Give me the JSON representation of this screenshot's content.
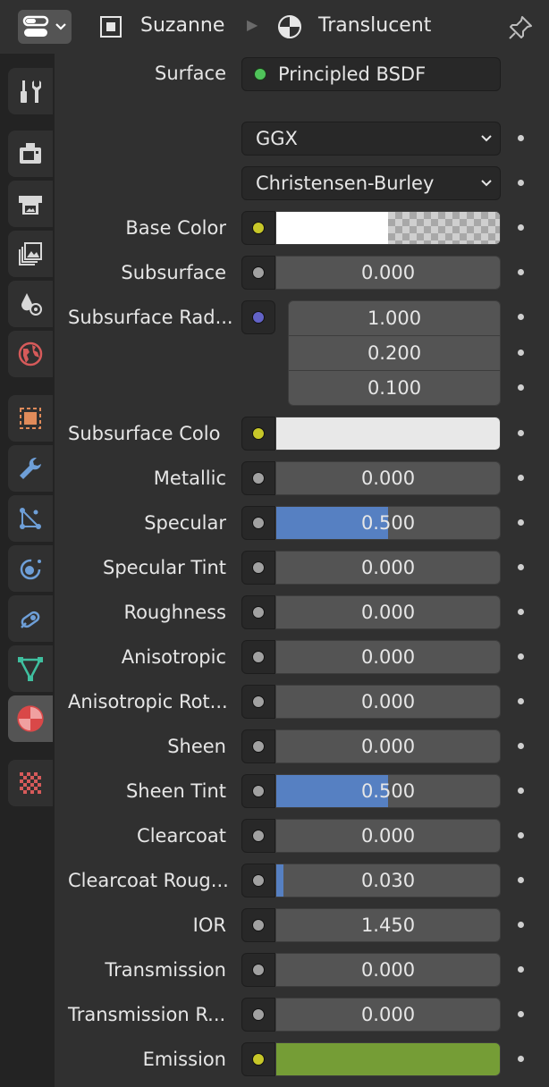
{
  "header": {
    "object_name": "Suzanne",
    "material_name": "Translucent"
  },
  "sidebar": {
    "tabs": [
      {
        "name": "tool-tab",
        "icon": "tool-icon"
      },
      {
        "name": "render-tab",
        "icon": "render-icon"
      },
      {
        "name": "output-tab",
        "icon": "output-icon"
      },
      {
        "name": "view-layer-tab",
        "icon": "view-layer-icon"
      },
      {
        "name": "scene-tab",
        "icon": "scene-icon"
      },
      {
        "name": "world-tab",
        "icon": "world-icon"
      },
      {
        "name": "object-tab",
        "icon": "object-icon"
      },
      {
        "name": "modifier-tab",
        "icon": "wrench-icon"
      },
      {
        "name": "particles-tab",
        "icon": "particles-icon"
      },
      {
        "name": "physics-tab",
        "icon": "physics-icon"
      },
      {
        "name": "constraints-tab",
        "icon": "constraints-icon"
      },
      {
        "name": "data-tab",
        "icon": "mesh-data-icon"
      },
      {
        "name": "material-tab",
        "icon": "material-icon",
        "active": true
      },
      {
        "name": "texture-tab",
        "icon": "texture-icon"
      }
    ]
  },
  "surface": {
    "label": "Surface",
    "value": "Principled BSDF"
  },
  "distribution": {
    "value": "GGX"
  },
  "subsurface_method": {
    "value": "Christensen-Burley"
  },
  "base_color": {
    "label": "Base Color",
    "color": "#ffffff",
    "alpha_shown": true
  },
  "subsurface": {
    "label": "Subsurface",
    "value": "0.000"
  },
  "subsurface_radius": {
    "label": "Subsurface Rad...",
    "values": [
      "1.000",
      "0.200",
      "0.100"
    ]
  },
  "subsurface_color": {
    "label": "Subsurface Colo",
    "color": "#e8e8e8"
  },
  "properties": [
    {
      "key": "metallic",
      "label": "Metallic",
      "value": "0.000",
      "fill": 0.0
    },
    {
      "key": "specular",
      "label": "Specular",
      "value": "0.500",
      "fill": 0.5
    },
    {
      "key": "specular-tint",
      "label": "Specular Tint",
      "value": "0.000",
      "fill": 0.0
    },
    {
      "key": "roughness",
      "label": "Roughness",
      "value": "0.000",
      "fill": 0.0
    },
    {
      "key": "anisotropic",
      "label": "Anisotropic",
      "value": "0.000",
      "fill": 0.0
    },
    {
      "key": "anisotropic-rotation",
      "label": "Anisotropic Rot...",
      "value": "0.000",
      "fill": 0.0
    },
    {
      "key": "sheen",
      "label": "Sheen",
      "value": "0.000",
      "fill": 0.0
    },
    {
      "key": "sheen-tint",
      "label": "Sheen Tint",
      "value": "0.500",
      "fill": 0.5
    },
    {
      "key": "clearcoat",
      "label": "Clearcoat",
      "value": "0.000",
      "fill": 0.0
    },
    {
      "key": "clearcoat-roughness",
      "label": "Clearcoat Roug...",
      "value": "0.030",
      "fill": 0.03
    },
    {
      "key": "ior",
      "label": "IOR",
      "value": "1.450",
      "fill": 0.0
    },
    {
      "key": "transmission",
      "label": "Transmission",
      "value": "0.000",
      "fill": 0.0
    },
    {
      "key": "transmission-roughness",
      "label": "Transmission R...",
      "value": "0.000",
      "fill": 0.0
    }
  ],
  "emission": {
    "label": "Emission",
    "color": "#759d36"
  },
  "colors": {
    "socket_grey": "#a1a1a1",
    "socket_yellow": "#c7c729",
    "socket_vector": "#6363c7",
    "socket_shader": "#4fc45a",
    "slider_fill": "#5680c2"
  }
}
